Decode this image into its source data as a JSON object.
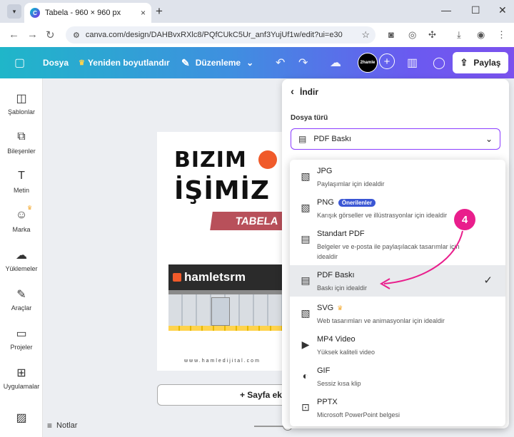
{
  "browser": {
    "tab_title": "Tabela - 960 × 960 px",
    "url": "canva.com/design/DAHBvxRXlc8/PQfCUkC5Ur_anf3YujUf1w/edit?ui=e30",
    "new_tab": "+",
    "close": "×",
    "minimize": "—",
    "maximize": "☐",
    "win_close": "✕"
  },
  "header": {
    "file": "Dosya",
    "resize": "Yeniden boyutlandır",
    "editing": "Düzenleme",
    "avatar": "2hamle",
    "share": "Paylaş"
  },
  "sidebar": {
    "items": [
      {
        "label": "Şablonlar",
        "icon": "templates-icon"
      },
      {
        "label": "Bileşenler",
        "icon": "elements-icon"
      },
      {
        "label": "Metin",
        "icon": "text-icon"
      },
      {
        "label": "Marka",
        "icon": "brand-icon"
      },
      {
        "label": "Yüklemeler",
        "icon": "uploads-icon"
      },
      {
        "label": "Araçlar",
        "icon": "tools-icon"
      },
      {
        "label": "Projeler",
        "icon": "projects-icon"
      },
      {
        "label": "Uygulamalar",
        "icon": "apps-icon"
      }
    ]
  },
  "canvas": {
    "line1": "BIZIM",
    "line2": "İŞİMİZ",
    "ribbon": "TABELA",
    "store_sign": "hamletsrm",
    "website": "www.hamledijital.com",
    "add_page": "+ Sayfa ekle",
    "notes": "Notlar"
  },
  "download": {
    "title": "İndir",
    "file_type_label": "Dosya türü",
    "selected": "PDF Baskı",
    "options": [
      {
        "name": "JPG",
        "desc": "Paylaşımlar için idealdir",
        "icon": "image-icon"
      },
      {
        "name": "PNG",
        "desc": "Karışık görseller ve illüstrasyonlar için idealdir",
        "badge": "Önerilenler",
        "icon": "image-icon"
      },
      {
        "name": "Standart PDF",
        "desc": "Belgeler ve e-posta ile paylaşılacak tasarımlar için idealdir",
        "icon": "document-icon"
      },
      {
        "name": "PDF Baskı",
        "desc": "Baskı için idealdir",
        "icon": "document-icon",
        "selected": true
      },
      {
        "name": "SVG",
        "desc": "Web tasarımları ve animasyonlar için idealdir",
        "icon": "image-icon",
        "premium": true
      },
      {
        "name": "MP4 Video",
        "desc": "Yüksek kaliteli video",
        "icon": "video-icon"
      },
      {
        "name": "GIF",
        "desc": "Sessiz kısa klip",
        "icon": "gif-icon"
      },
      {
        "name": "PPTX",
        "desc": "Microsoft PowerPoint belgesi",
        "icon": "presentation-icon"
      }
    ]
  },
  "annotation": {
    "step": "4",
    "color": "#e91e8c"
  }
}
